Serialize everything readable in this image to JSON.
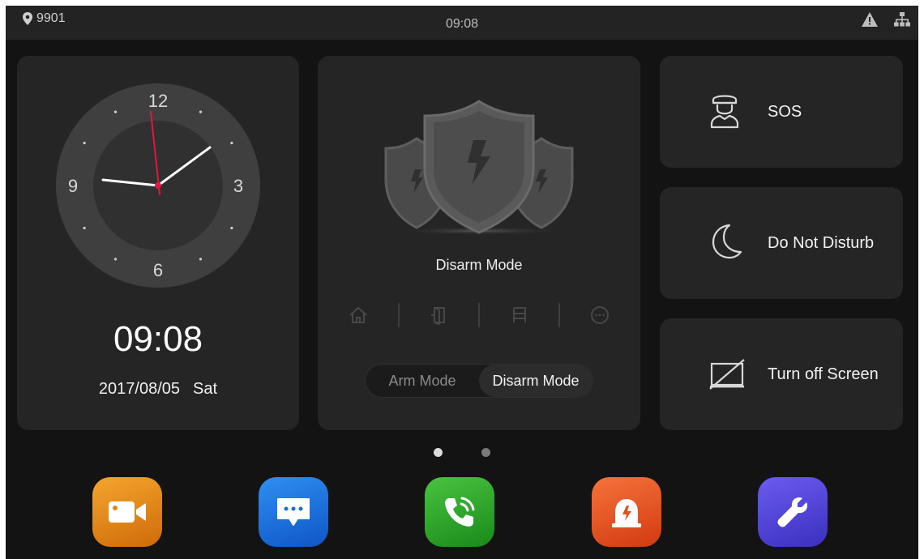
{
  "status_bar": {
    "device_id": "9901",
    "time": "09:08",
    "icons": [
      "location-pin-icon",
      "warning-icon",
      "network-icon"
    ]
  },
  "clock": {
    "dial_numbers": [
      "12",
      "3",
      "6",
      "9"
    ],
    "digital_time": "09:08",
    "date": "2017/08/05",
    "weekday": "Sat"
  },
  "security": {
    "mode_label": "Disarm Mode",
    "zone_icons": [
      "home-icon",
      "door-icon",
      "bed-icon",
      "more-icon"
    ],
    "toggle": {
      "options": [
        "Arm Mode",
        "Disarm Mode"
      ],
      "selected": "Disarm Mode"
    }
  },
  "quick_actions": [
    {
      "label": "SOS",
      "icon": "guard-icon"
    },
    {
      "label": "Do Not Disturb",
      "icon": "moon-icon"
    },
    {
      "label": "Turn off Screen",
      "icon": "screen-off-icon"
    }
  ],
  "pager": {
    "pages": 2,
    "current": 1
  },
  "dock": [
    {
      "icon": "video-camera-icon",
      "color": "#e8891a"
    },
    {
      "icon": "message-icon",
      "color": "#1f74de"
    },
    {
      "icon": "phone-call-icon",
      "color": "#2ea52b"
    },
    {
      "icon": "alarm-icon",
      "color": "#e9551f"
    },
    {
      "icon": "wrench-icon",
      "color": "#4f42d8"
    }
  ],
  "colors": {
    "background": "#131313",
    "card": "#252525",
    "second_hand": "#e3173c"
  }
}
